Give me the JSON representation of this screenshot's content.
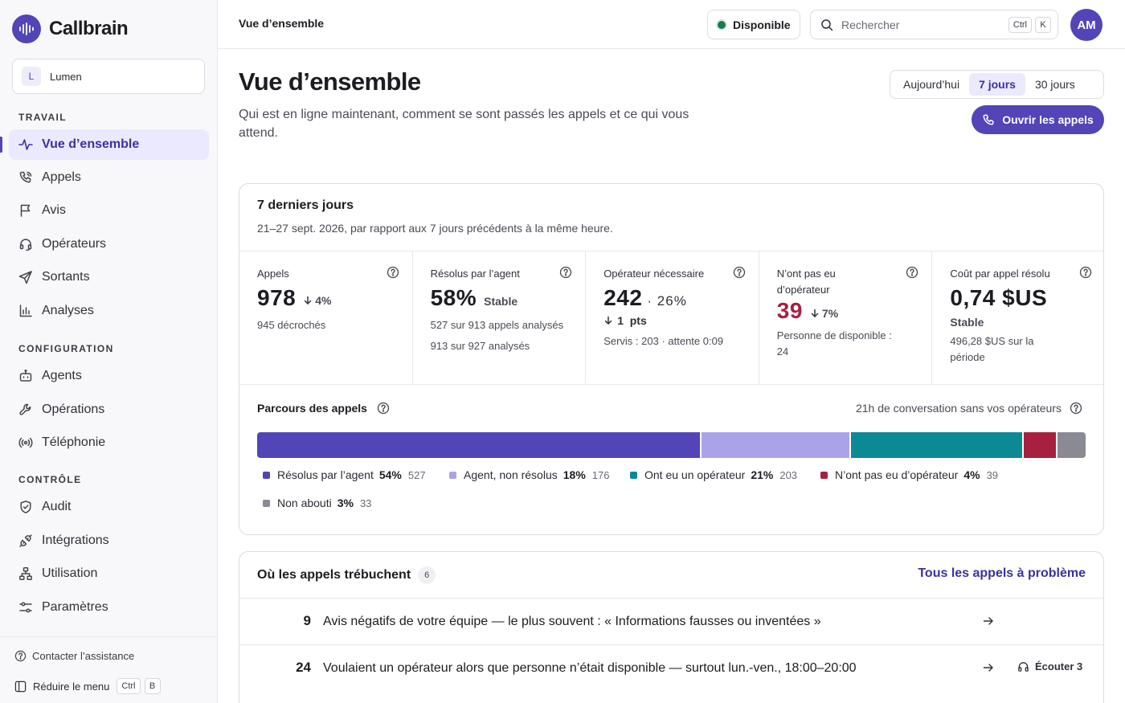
{
  "app": {
    "name": "Callbrain"
  },
  "workspace": {
    "badge": "L",
    "name": "Lumen"
  },
  "sidebar": {
    "sections": [
      {
        "label": "TRAVAIL"
      },
      {
        "label": "CONFIGURATION"
      },
      {
        "label": "CONTRÔLE"
      }
    ],
    "items": [
      {
        "label": "Vue d’ensemble",
        "icon": "activity-icon",
        "active": true
      },
      {
        "label": "Appels",
        "icon": "phone-call-icon"
      },
      {
        "label": "Avis",
        "icon": "flag-icon"
      },
      {
        "label": "Opérateurs",
        "icon": "headset-icon"
      },
      {
        "label": "Sortants",
        "icon": "send-icon"
      },
      {
        "label": "Analyses",
        "icon": "bar-chart-icon"
      },
      {
        "label": "Agents",
        "icon": "bot-icon"
      },
      {
        "label": "Opérations",
        "icon": "wrench-icon"
      },
      {
        "label": "Téléphonie",
        "icon": "radio-icon"
      },
      {
        "label": "Audit",
        "icon": "shield-icon"
      },
      {
        "label": "Intégrations",
        "icon": "plug-icon"
      },
      {
        "label": "Utilisation",
        "icon": "network-icon"
      },
      {
        "label": "Paramètres",
        "icon": "sliders-icon"
      }
    ],
    "support": "Contacter l’assistance",
    "collapse": {
      "label": "Réduire le menu",
      "key1": "Ctrl",
      "key2": "B"
    }
  },
  "header": {
    "breadcrumb": "Vue d’ensemble",
    "status": "Disponible",
    "search": {
      "placeholder": "Rechercher",
      "key1": "Ctrl",
      "key2": "K"
    },
    "avatar": "AM"
  },
  "page": {
    "title": "Vue d’ensemble",
    "subtitle": "Qui est en ligne maintenant, comment se sont passés les appels et ce qui vous attend.",
    "ranges": [
      "Aujourd’hui",
      "7 jours",
      "30 jours"
    ],
    "selected_range": "7 jours",
    "primary_action": "Ouvrir les appels"
  },
  "summary": {
    "title": "7 derniers jours",
    "subtitle": "21–27 sept. 2026, par rapport aux 7 jours précédents à la même heure.",
    "kpis": [
      {
        "label": "Appels",
        "value": "978",
        "delta": "4%",
        "note": "945 décrochés"
      },
      {
        "label": "Résolus par l’agent",
        "value": "58%",
        "delta": "Stable",
        "note": "527 sur 913 appels analysés",
        "note2": "913 sur 927 analysés"
      },
      {
        "label": "Opérateur nécessaire",
        "value": "242",
        "value_suffix": "· 26%",
        "delta": "1  pts",
        "note": "Servis : 203 · attente 0:09"
      },
      {
        "label": "N’ont pas eu d’opérateur",
        "value": "39",
        "delta": "7%",
        "note": "Personne de disponible : 24"
      },
      {
        "label": "Coût par appel résolu",
        "value": "0,74 $US",
        "delta": "Stable",
        "note": "496,28 $US sur la période"
      }
    ],
    "journey": {
      "title": "Parcours des appels",
      "right_note": "21h de conversation sans vos opérateurs"
    }
  },
  "chart_data": {
    "type": "bar",
    "categories": [
      "Résolus par l’agent",
      "Agent, non résolus",
      "Ont eu un opérateur",
      "N’ont pas eu d’opérateur",
      "Non abouti"
    ],
    "values": [
      527,
      176,
      203,
      39,
      33
    ],
    "percent_labels": [
      "54%",
      "18%",
      "21%",
      "4%",
      "3%"
    ],
    "count_labels": [
      "527",
      "176",
      "203",
      "39",
      "33"
    ],
    "colors": [
      "#5145b8",
      "#aaa3ea",
      "#0b8a96",
      "#a8203f",
      "#8a8a94"
    ],
    "stacked": true,
    "orientation": "horizontal",
    "legend": "bottom"
  },
  "issues": {
    "title": "Où les appels trébuchent",
    "count": "6",
    "link": "Tous les appels à problème",
    "rows": [
      {
        "num": "9",
        "text": "Avis négatifs de votre équipe — le plus souvent : « Informations fausses ou inventées »"
      },
      {
        "num": "24",
        "text": "Voulaient un opérateur alors que personne n’était disponible — surtout lun.-ven., 18:00–20:00",
        "action": "Écouter 3"
      }
    ]
  }
}
